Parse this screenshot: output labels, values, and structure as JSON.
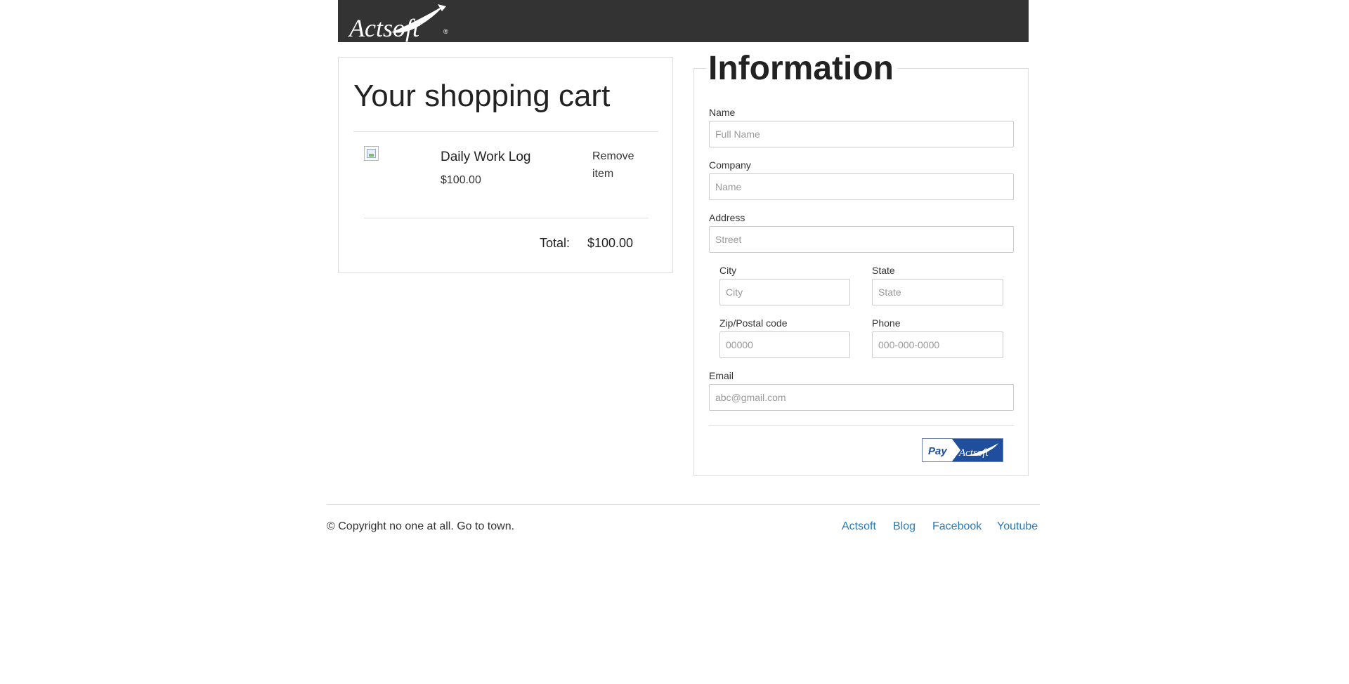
{
  "header": {
    "logo_text": "Actsoft",
    "logo_icon": "actsoft-logo"
  },
  "cart": {
    "title": "Your shopping cart",
    "items": [
      {
        "image_icon": "broken-image-icon",
        "name": "Daily Work Log",
        "price": "$100.00",
        "remove_label": "Remove item"
      }
    ],
    "total_label": "Total:",
    "total_value": "$100.00"
  },
  "form": {
    "title": "Information",
    "fields": {
      "name": {
        "label": "Name",
        "placeholder": "Full Name"
      },
      "company": {
        "label": "Company",
        "placeholder": "Name"
      },
      "address": {
        "label": "Address",
        "placeholder": "Street"
      },
      "city": {
        "label": "City",
        "placeholder": "City"
      },
      "state": {
        "label": "State",
        "placeholder": "State"
      },
      "zip": {
        "label": "Zip/Postal code",
        "placeholder": "00000"
      },
      "phone": {
        "label": "Phone",
        "placeholder": "000-000-0000"
      },
      "email": {
        "label": "Email",
        "placeholder": "abc@gmail.com"
      }
    },
    "pay_button": {
      "pay_text": "Pay",
      "brand_text": "Actsoft",
      "brand_color": "#1f4e9c"
    }
  },
  "footer": {
    "copyright": "© Copyright no one at all. Go to town.",
    "links": [
      "Actsoft",
      "Blog",
      "Facebook",
      "Youtube"
    ],
    "link_color": "#2a7ab8"
  },
  "colors": {
    "header_bg": "#333333",
    "border": "#dddddd",
    "text": "#333333"
  }
}
